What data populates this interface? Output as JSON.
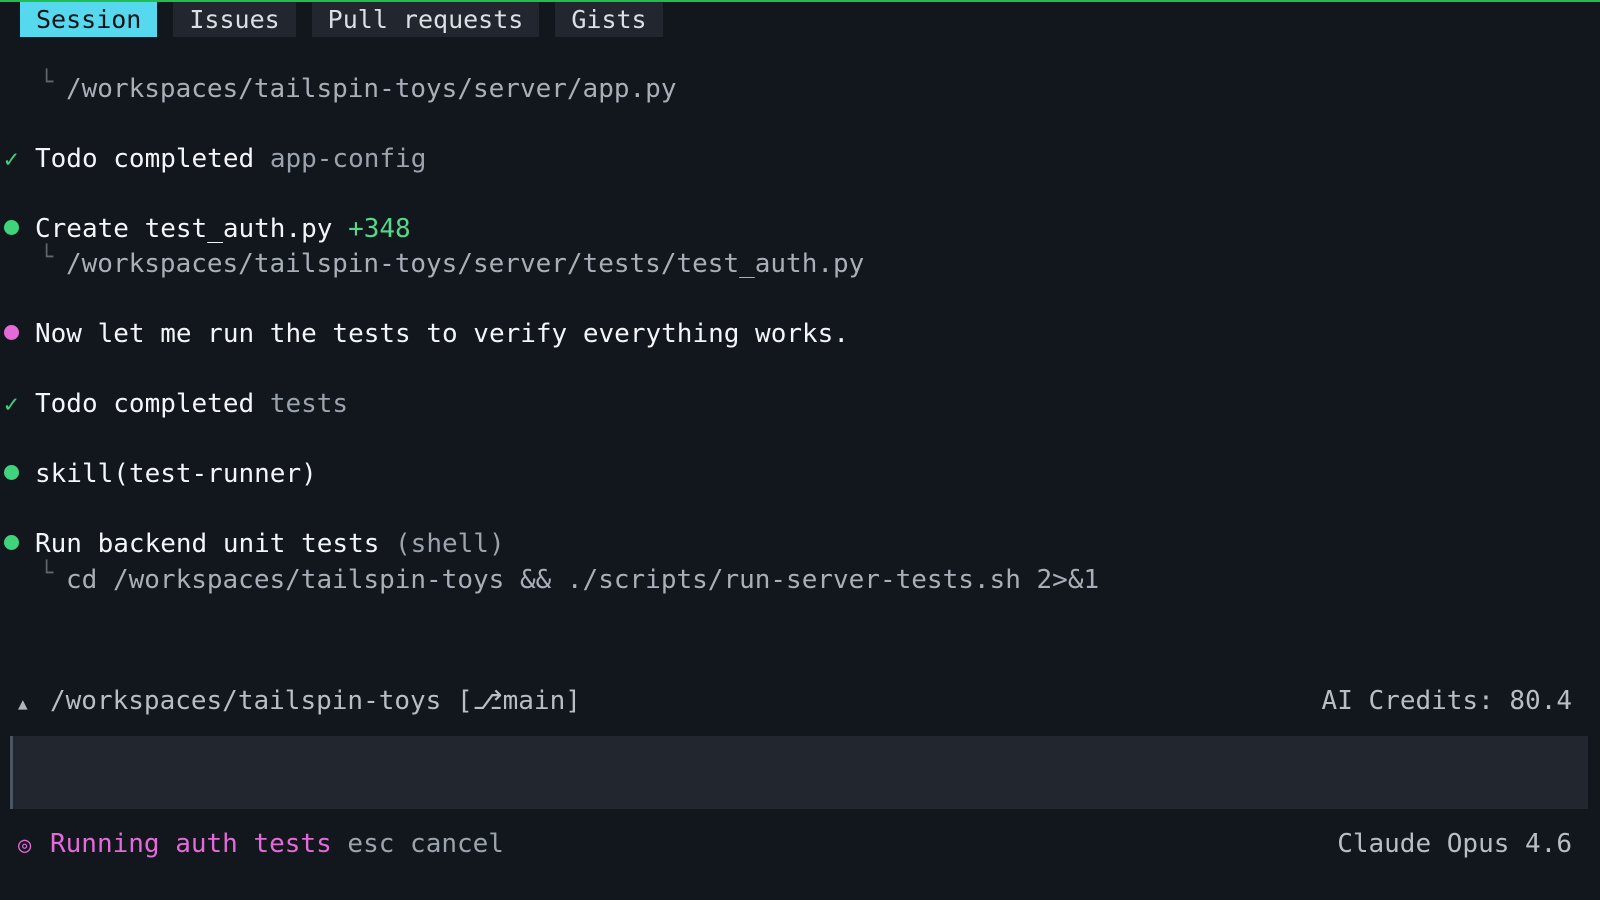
{
  "tabs": [
    "Session",
    "Issues",
    "Pull requests",
    "Gists"
  ],
  "log": {
    "line1": {
      "path": "/workspaces/tailspin-toys/server/app.py"
    },
    "line2": {
      "status": "Todo completed",
      "item": "app-config"
    },
    "line3": {
      "action": "Create",
      "file": "test_auth.py",
      "diff": "+348",
      "path": "/workspaces/tailspin-toys/server/tests/test_auth.py"
    },
    "line4": {
      "message": "Now let me run the tests to verify everything works."
    },
    "line5": {
      "status": "Todo completed",
      "item": "tests"
    },
    "line6": {
      "skill": "skill(test-runner)"
    },
    "line7": {
      "title": "Run backend unit tests",
      "type": "(shell)",
      "command": "cd /workspaces/tailspin-toys && ./scripts/run-server-tests.sh 2>&1"
    }
  },
  "footer": {
    "path": "/workspaces/tailspin-toys",
    "branch_prefix": "[",
    "branch_icon": "⎇",
    "branch": "main]",
    "credits": "AI Credits: 80.4",
    "running": "Running auth tests",
    "cancel": "esc cancel",
    "model": "Claude Opus 4.6"
  },
  "icons": {
    "check": "✓",
    "tree": "└",
    "spinner": "◎",
    "caret": "▲"
  },
  "colors": {
    "active_tab": "#56d9ef",
    "success": "#3fd37b",
    "activity": "#e56ad9",
    "background": "#12161d"
  }
}
